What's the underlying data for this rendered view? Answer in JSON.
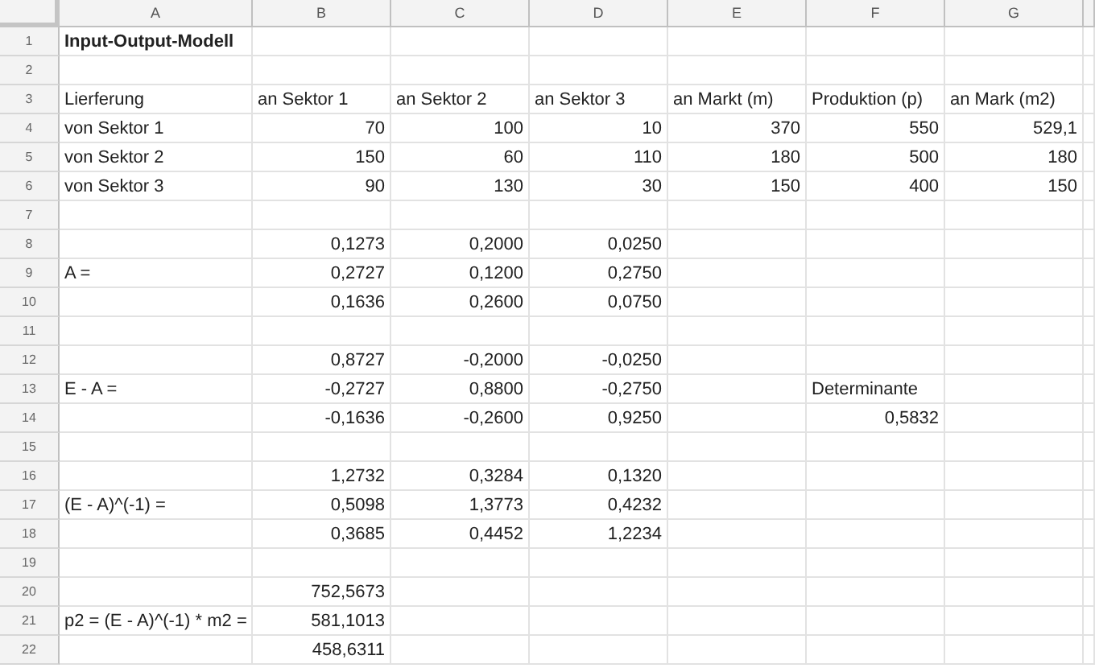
{
  "columns": [
    "A",
    "B",
    "C",
    "D",
    "E",
    "F",
    "G"
  ],
  "rows": [
    {
      "number": "1",
      "cells": [
        {
          "text": "Input-Output-Modell",
          "kind": "title"
        }
      ]
    },
    {
      "number": "2"
    },
    {
      "number": "3",
      "cells": [
        {
          "text": "Lierferung",
          "kind": "label"
        },
        {
          "text": "an Sektor 1",
          "kind": "label"
        },
        {
          "text": "an Sektor 2",
          "kind": "label"
        },
        {
          "text": "an Sektor 3",
          "kind": "label"
        },
        {
          "text": "an Markt (m)",
          "kind": "label"
        },
        {
          "text": "Produktion (p)",
          "kind": "label"
        },
        {
          "text": "an Mark (m2)",
          "kind": "label"
        }
      ]
    },
    {
      "number": "4",
      "cells": [
        {
          "text": "von Sektor 1",
          "kind": "label"
        },
        {
          "text": "70",
          "kind": "number"
        },
        {
          "text": "100",
          "kind": "number"
        },
        {
          "text": "10",
          "kind": "number"
        },
        {
          "text": "370",
          "kind": "number"
        },
        {
          "text": "550",
          "kind": "number"
        },
        {
          "text": "529,1",
          "kind": "number"
        }
      ]
    },
    {
      "number": "5",
      "cells": [
        {
          "text": "von Sektor 2",
          "kind": "label"
        },
        {
          "text": "150",
          "kind": "number"
        },
        {
          "text": "60",
          "kind": "number"
        },
        {
          "text": "110",
          "kind": "number"
        },
        {
          "text": "180",
          "kind": "number"
        },
        {
          "text": "500",
          "kind": "number"
        },
        {
          "text": "180",
          "kind": "number"
        }
      ]
    },
    {
      "number": "6",
      "cells": [
        {
          "text": "von Sektor 3",
          "kind": "label"
        },
        {
          "text": "90",
          "kind": "number"
        },
        {
          "text": "130",
          "kind": "number"
        },
        {
          "text": "30",
          "kind": "number"
        },
        {
          "text": "150",
          "kind": "number"
        },
        {
          "text": "400",
          "kind": "number"
        },
        {
          "text": "150",
          "kind": "number"
        }
      ]
    },
    {
      "number": "7"
    },
    {
      "number": "8",
      "cells": [
        null,
        {
          "text": "0,1273",
          "kind": "number"
        },
        {
          "text": "0,2000",
          "kind": "number"
        },
        {
          "text": "0,0250",
          "kind": "number"
        }
      ]
    },
    {
      "number": "9",
      "cells": [
        {
          "text": "A =",
          "kind": "label"
        },
        {
          "text": "0,2727",
          "kind": "number"
        },
        {
          "text": "0,1200",
          "kind": "number"
        },
        {
          "text": "0,2750",
          "kind": "number"
        }
      ]
    },
    {
      "number": "10",
      "cells": [
        null,
        {
          "text": "0,1636",
          "kind": "number"
        },
        {
          "text": "0,2600",
          "kind": "number"
        },
        {
          "text": "0,0750",
          "kind": "number"
        }
      ]
    },
    {
      "number": "11"
    },
    {
      "number": "12",
      "cells": [
        null,
        {
          "text": "0,8727",
          "kind": "number"
        },
        {
          "text": "-0,2000",
          "kind": "number"
        },
        {
          "text": "-0,0250",
          "kind": "number"
        }
      ]
    },
    {
      "number": "13",
      "cells": [
        {
          "text": "E - A =",
          "kind": "label"
        },
        {
          "text": "-0,2727",
          "kind": "number"
        },
        {
          "text": "0,8800",
          "kind": "number"
        },
        {
          "text": "-0,2750",
          "kind": "number"
        },
        null,
        {
          "text": "Determinante",
          "kind": "label"
        }
      ]
    },
    {
      "number": "14",
      "cells": [
        null,
        {
          "text": "-0,1636",
          "kind": "number"
        },
        {
          "text": "-0,2600",
          "kind": "number"
        },
        {
          "text": "0,9250",
          "kind": "number"
        },
        null,
        {
          "text": "0,5832",
          "kind": "number"
        }
      ]
    },
    {
      "number": "15"
    },
    {
      "number": "16",
      "cells": [
        null,
        {
          "text": "1,2732",
          "kind": "number"
        },
        {
          "text": "0,3284",
          "kind": "number"
        },
        {
          "text": "0,1320",
          "kind": "number"
        }
      ]
    },
    {
      "number": "17",
      "cells": [
        {
          "text": "(E - A)^(-1) =",
          "kind": "label"
        },
        {
          "text": "0,5098",
          "kind": "number"
        },
        {
          "text": "1,3773",
          "kind": "number"
        },
        {
          "text": "0,4232",
          "kind": "number"
        }
      ]
    },
    {
      "number": "18",
      "cells": [
        null,
        {
          "text": "0,3685",
          "kind": "number"
        },
        {
          "text": "0,4452",
          "kind": "number"
        },
        {
          "text": "1,2234",
          "kind": "number"
        }
      ]
    },
    {
      "number": "19"
    },
    {
      "number": "20",
      "cells": [
        null,
        {
          "text": "752,5673",
          "kind": "number"
        }
      ]
    },
    {
      "number": "21",
      "cells": [
        {
          "text": "p2 = (E - A)^(-1) * m2 =",
          "kind": "label"
        },
        {
          "text": "581,1013",
          "kind": "number"
        }
      ]
    },
    {
      "number": "22",
      "cells": [
        null,
        {
          "text": "458,6311",
          "kind": "number"
        }
      ]
    }
  ]
}
